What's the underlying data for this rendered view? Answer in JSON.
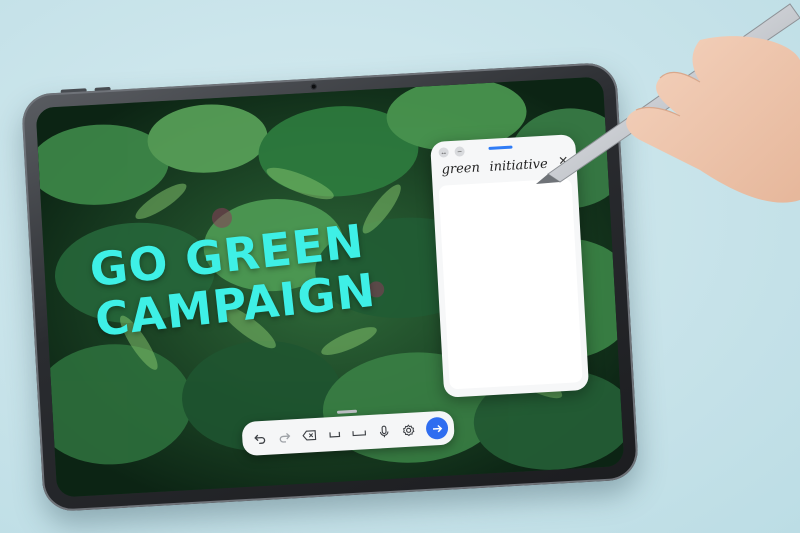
{
  "campaign": {
    "headline_line1": "GO GREEN",
    "headline_line2": "CAMPAIGN"
  },
  "handwriting_panel": {
    "word_1": "green",
    "word_2": "initiative",
    "close_glyph": "✕"
  },
  "toolbar": {
    "icons": [
      "undo-icon",
      "redo-icon",
      "backspace-icon",
      "space-icon",
      "space-wide-icon",
      "microphone-icon",
      "settings-icon",
      "send-arrow-icon"
    ]
  },
  "colors": {
    "headline": "#3ef0e6",
    "accent_blue": "#2f6df0",
    "background": "#cfe6ec"
  }
}
